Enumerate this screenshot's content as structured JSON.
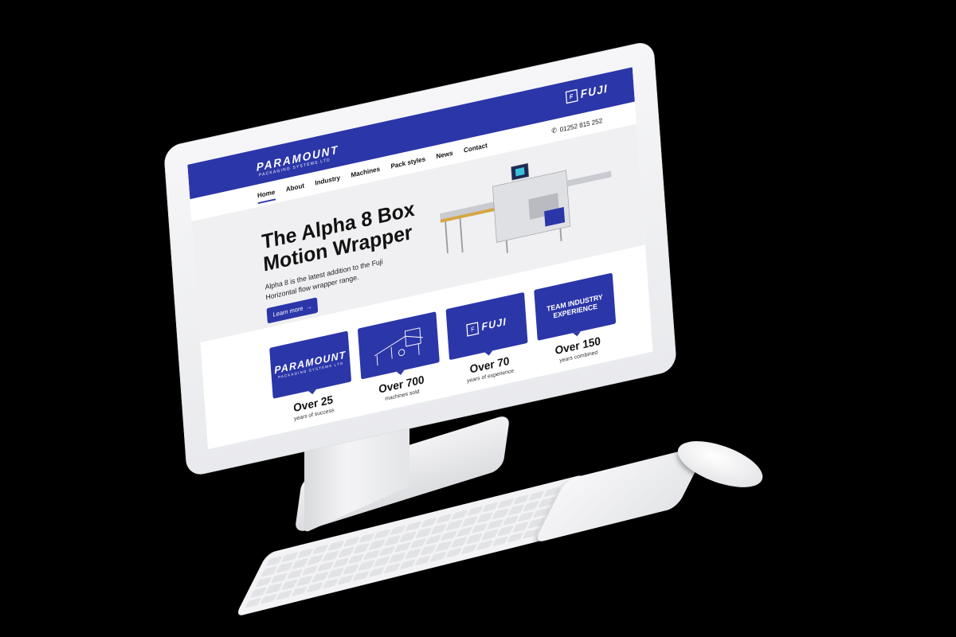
{
  "site": {
    "logo": {
      "word": "PARAMOUNT",
      "sub": "PACKAGING SYSTEMS LTD"
    },
    "partner_logo": {
      "mark": "F",
      "word": "FUJI"
    },
    "phone": "01252 815 252"
  },
  "nav": {
    "items": [
      {
        "label": "Home",
        "active": true
      },
      {
        "label": "About"
      },
      {
        "label": "Industry"
      },
      {
        "label": "Machines"
      },
      {
        "label": "Pack styles"
      },
      {
        "label": "News"
      },
      {
        "label": "Contact"
      }
    ]
  },
  "hero": {
    "title": "The Alpha 8 Box Motion Wrapper",
    "text": "Alpha 8 is the latest addition to the Fuji Horizontal flow wrapper range.",
    "button": "Learn more"
  },
  "stats": [
    {
      "card": "logo",
      "card_word": "PARAMOUNT",
      "card_sub": "PACKAGING SYSTEMS LTD",
      "value": "Over 25",
      "caption": "years of success"
    },
    {
      "card": "machine-icon",
      "value": "Over 700",
      "caption": "machines sold"
    },
    {
      "card": "logo",
      "card_word": "FUJI",
      "value": "Over 70",
      "caption": "years of experience"
    },
    {
      "card": "text",
      "card_text": "TEAM INDUSTRY EXPERIENCE",
      "value": "Over 150",
      "caption": "years combined"
    }
  ],
  "colors": {
    "brand": "#2b36a8",
    "hero_bg": "#f0f0f3",
    "device": "#f3f3f5"
  }
}
